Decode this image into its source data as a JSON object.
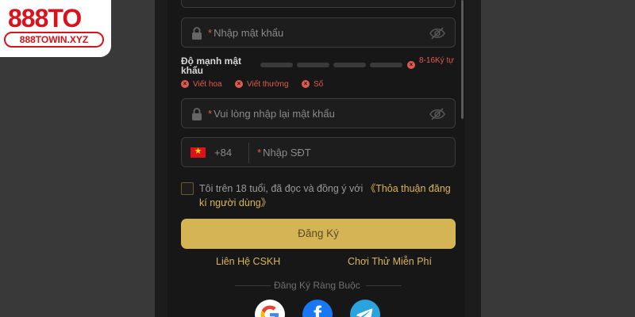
{
  "brand": {
    "logo_text": "888TO",
    "domain": "888TOWIN.XYZ"
  },
  "form": {
    "password": {
      "required_mark": "*",
      "placeholder": "Nhập mật khẩu",
      "icon": "lock-icon",
      "toggle_icon": "eye-off-icon"
    },
    "strength": {
      "label": "Độ mạnh mật khẩu",
      "bars_filled": 0,
      "bars_total": 4,
      "range_icon": "x-circle-icon",
      "range": "8-16Ký tự",
      "rules": [
        {
          "icon": "x-circle-icon",
          "label": "Viết hoa"
        },
        {
          "icon": "x-circle-icon",
          "label": "Viết thường"
        },
        {
          "icon": "x-circle-icon",
          "label": "Số"
        }
      ]
    },
    "confirm_password": {
      "required_mark": "*",
      "placeholder": "Vui lòng nhập lại mật khẩu",
      "icon": "lock-icon",
      "toggle_icon": "eye-off-icon"
    },
    "phone": {
      "flag_icon": "vietnam-flag-icon",
      "dial_code": "+84",
      "required_mark": "*",
      "placeholder": "Nhập SĐT"
    },
    "agreement": {
      "checked": false,
      "text": "Tôi trên 18 tuổi, đã đọc và đồng ý với",
      "link": "《Thỏa thuận đăng kí người dùng》"
    },
    "register_button": "Đăng Ký"
  },
  "links": {
    "support": "Liên Hệ CSKH",
    "trial": "Chơi Thử Miễn Phí"
  },
  "social_bind": {
    "label": "Đăng Ký Ràng Buộc",
    "providers": [
      "google-icon",
      "facebook-icon",
      "telegram-icon"
    ]
  },
  "colors": {
    "accent_gold": "#d5b455",
    "link_gold": "#d9b65a",
    "error_red": "#e05a4f",
    "brand_red": "#d9121b",
    "panel_bg": "#171717"
  }
}
